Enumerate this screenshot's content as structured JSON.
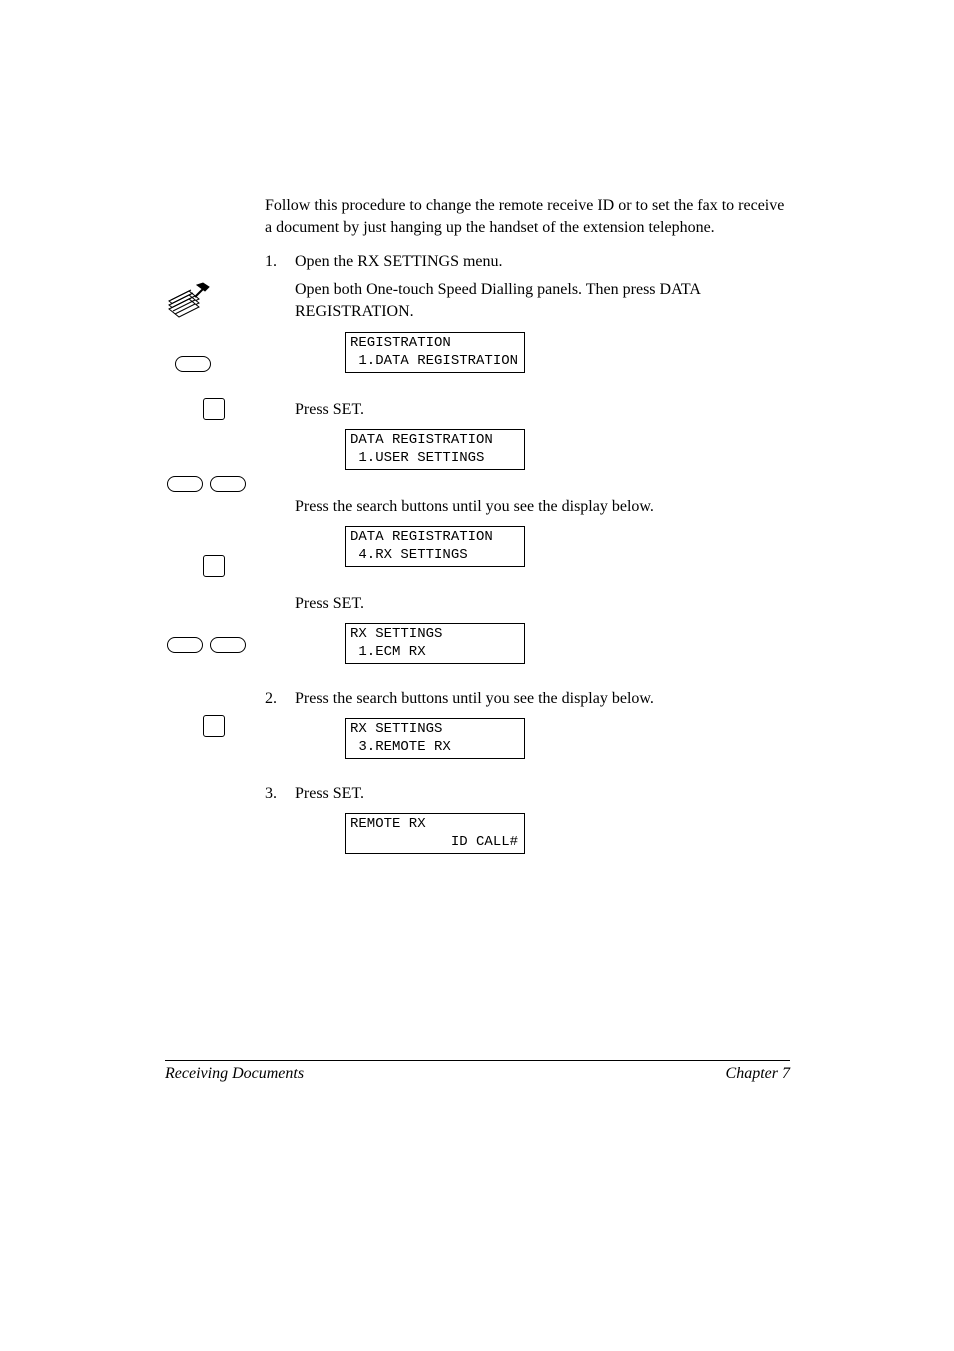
{
  "intro": "Follow this procedure to change the remote receive ID or to set the fax to receive a document by just hanging up the handset of the extension telephone.",
  "steps": [
    {
      "number": "1.",
      "text": "Open the RX SETTINGS menu.",
      "subs": [
        {
          "text": "Open both One-touch Speed Dialling panels. Then press DATA REGISTRATION.",
          "display": "REGISTRATION\n 1.DATA REGISTRATION"
        },
        {
          "text": "Press SET.",
          "display": "DATA REGISTRATION\n 1.USER SETTINGS"
        },
        {
          "text": "Press the search buttons until you see the display below.",
          "display": "DATA REGISTRATION\n 4.RX SETTINGS"
        },
        {
          "text": "Press SET.",
          "display": "RX SETTINGS\n 1.ECM RX"
        }
      ]
    },
    {
      "number": "2.",
      "text": "Press the search buttons until you see the display below.",
      "display": "RX SETTINGS\n 3.REMOTE RX"
    },
    {
      "number": "3.",
      "text": "Press SET.",
      "display": "REMOTE RX\n            ID CALL#"
    }
  ],
  "footer": {
    "left": "Receiving Documents",
    "right": "Chapter 7"
  }
}
